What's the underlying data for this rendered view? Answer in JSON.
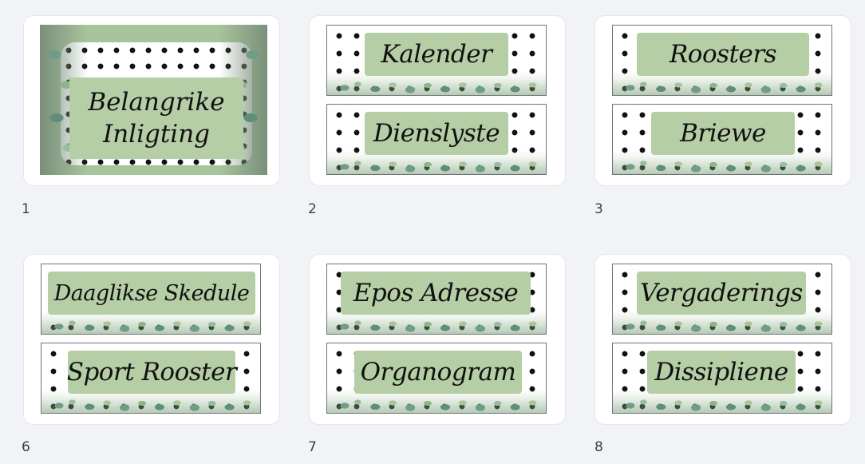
{
  "pages": [
    {
      "number": "1",
      "lines": [
        "Belangrike",
        "Inligting"
      ]
    },
    {
      "number": "2",
      "labels": [
        "Kalender",
        "Dienslyste"
      ]
    },
    {
      "number": "3",
      "labels": [
        "Roosters",
        "Briewe"
      ]
    },
    {
      "number": "6",
      "labels": [
        "Daaglikse Skedule",
        "Sport Rooster"
      ]
    },
    {
      "number": "7",
      "labels": [
        "Epos Adresse",
        "Organogram"
      ]
    },
    {
      "number": "8",
      "labels": [
        "Vergaderings",
        "Dissipliene"
      ]
    }
  ]
}
